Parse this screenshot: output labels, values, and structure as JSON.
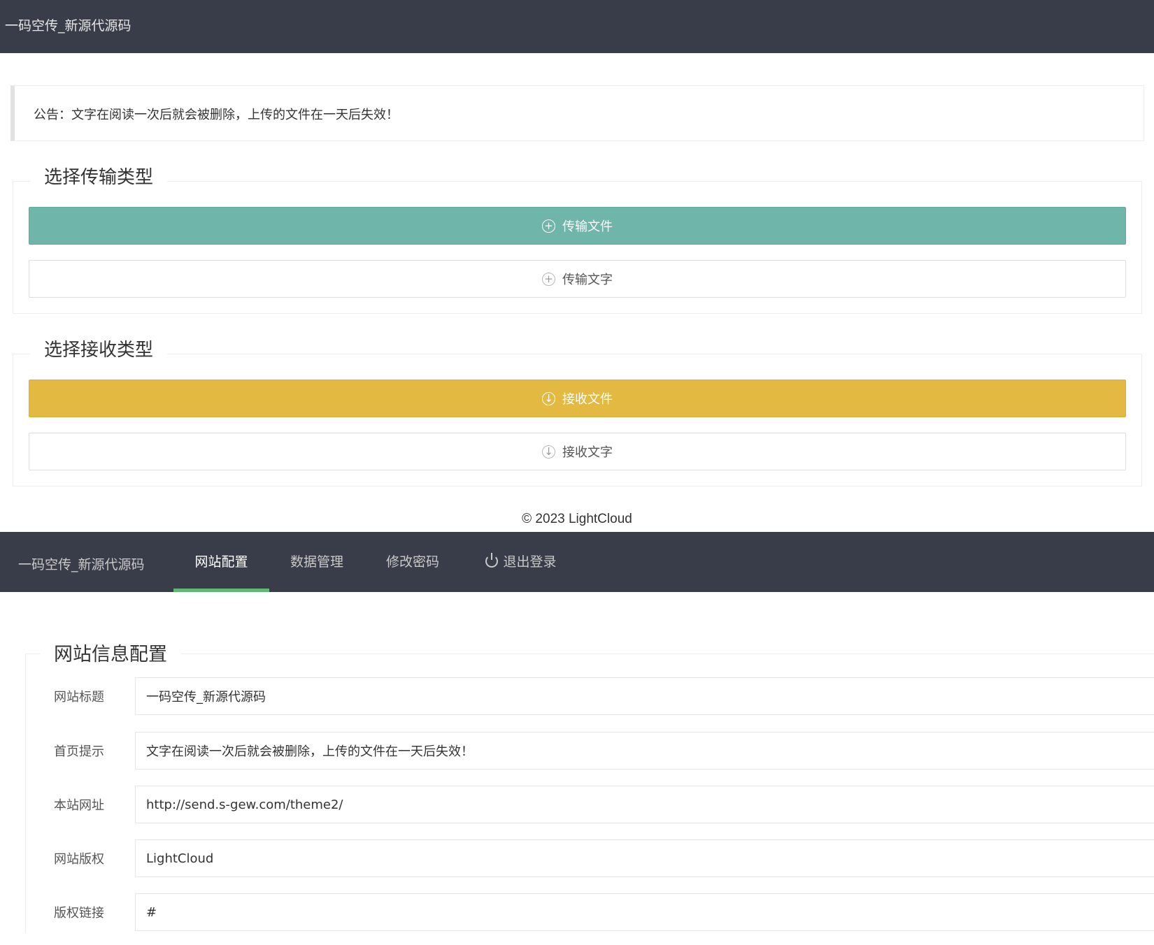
{
  "top": {
    "site_title": "一码空传_新源代源码",
    "notice": "公告：文字在阅读一次后就会被删除，上传的文件在一天后失效！",
    "send_section": {
      "legend": "选择传输类型",
      "send_file": {
        "label": "传输文件",
        "icon": "plus-circle-icon"
      },
      "send_text": {
        "label": "传输文字",
        "icon": "plus-circle-icon"
      }
    },
    "receive_section": {
      "legend": "选择接收类型",
      "receive_file": {
        "label": "接收文件",
        "icon": "download-circle-icon"
      },
      "receive_text": {
        "label": "接收文字",
        "icon": "download-circle-icon"
      }
    },
    "copyright": "© 2023 LightCloud",
    "colors": {
      "header": "#393d49",
      "send_button": "#70b5a9",
      "receive_button": "#e3b941"
    }
  },
  "admin": {
    "logo": "一码空传_新源代源码",
    "nav": [
      {
        "label": "网站配置",
        "active": true
      },
      {
        "label": "数据管理",
        "active": false
      },
      {
        "label": "修改密码",
        "active": false
      },
      {
        "label": "退出登录",
        "active": false,
        "icon": "power-icon"
      }
    ],
    "colors": {
      "nav_active_indicator": "#5fb878"
    },
    "form": {
      "legend": "网站信息配置",
      "fields": [
        {
          "label": "网站标题",
          "value": "一码空传_新源代源码"
        },
        {
          "label": "首页提示",
          "value": "文字在阅读一次后就会被删除，上传的文件在一天后失效！"
        },
        {
          "label": "本站网址",
          "value": "http://send.s-gew.com/theme2/"
        },
        {
          "label": "网站版权",
          "value": "LightCloud"
        },
        {
          "label": "版权链接",
          "value": "#"
        }
      ]
    }
  }
}
